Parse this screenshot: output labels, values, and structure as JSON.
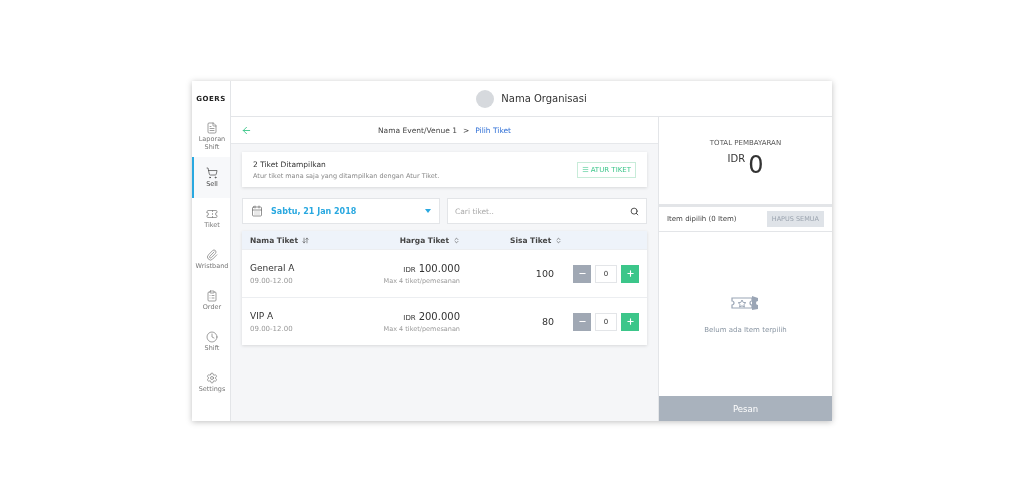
{
  "logo": "GOERS",
  "sidebar": {
    "items": [
      {
        "label": "Laporan Shift",
        "selected": false
      },
      {
        "label": "Sell",
        "selected": true
      },
      {
        "label": "Tiket",
        "selected": false
      },
      {
        "label": "Wristband",
        "selected": false
      },
      {
        "label": "Order",
        "selected": false
      },
      {
        "label": "Shift",
        "selected": false
      },
      {
        "label": "Settings",
        "selected": false
      }
    ]
  },
  "header": {
    "organization": "Nama Organisasi"
  },
  "breadcrumb": {
    "parent": "Nama Event/Venue 1",
    "separator": ">",
    "current": "Pilih Tiket"
  },
  "notice": {
    "title": "2 Tiket Ditampilkan",
    "text": "Atur tiket mana saja yang ditampilkan dengan Atur Tiket.",
    "button": "ATUR TIKET"
  },
  "date_select": {
    "value": "Sabtu, 21 Jan 2018"
  },
  "search": {
    "placeholder": "Cari tiket.."
  },
  "table": {
    "columns": [
      "Nama Tiket",
      "Harga Tiket",
      "Sisa Tiket"
    ],
    "rows": [
      {
        "name": "General A",
        "time": "09.00-12.00",
        "currency": "IDR",
        "price": "100.000",
        "limit": "Max 4 tiket/pemesanan",
        "remaining": "100",
        "quantity": "0",
        "decrement_disabled": true
      },
      {
        "name": "VIP A",
        "time": "09.00-12.00",
        "currency": "IDR",
        "price": "200.000",
        "limit": "Max 4 tiket/pemesanan",
        "remaining": "80",
        "quantity": "0",
        "decrement_disabled": true
      }
    ]
  },
  "total": {
    "label": "TOTAL PEMBAYARAN",
    "currency": "IDR",
    "amount": "0"
  },
  "selected_items": {
    "title": "Item dipilih (0 Item)",
    "clear_button": "HAPUS SEMUA",
    "clear_disabled": true,
    "empty_text": "Belum ada Item terpilih"
  },
  "order_button": {
    "label": "Pesan",
    "disabled": true
  }
}
